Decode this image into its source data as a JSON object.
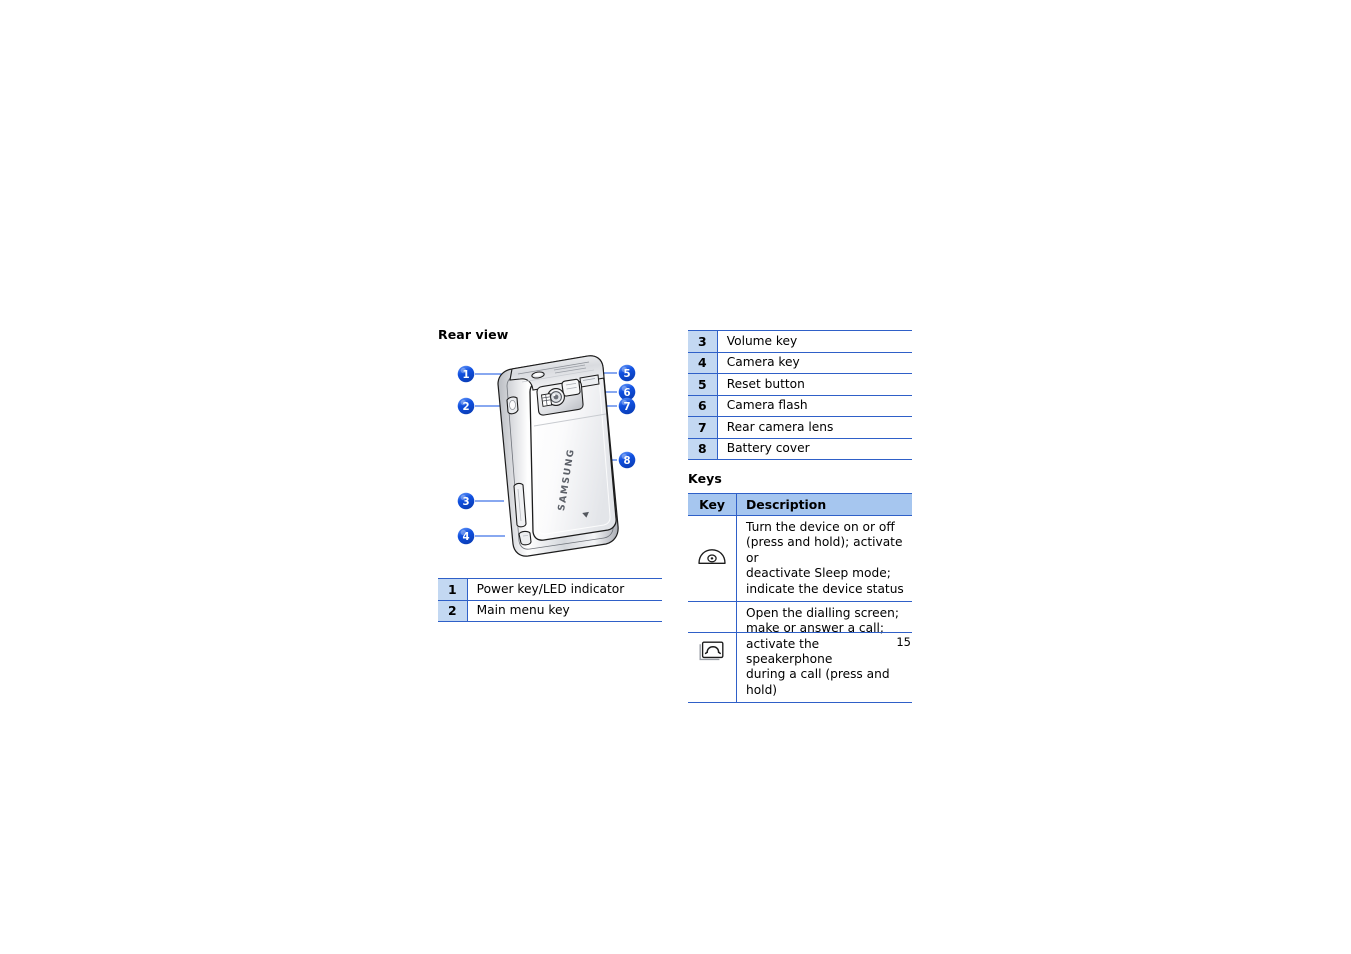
{
  "document": {
    "page_number": "15"
  },
  "rear_view": {
    "heading": "Rear view",
    "illustration": {
      "brand_logo": "SAMSUNG",
      "callouts": [
        "1",
        "2",
        "3",
        "4",
        "5",
        "6",
        "7",
        "8"
      ]
    },
    "table_left": {
      "rows": [
        {
          "num": "1",
          "desc": "Power key/LED indicator"
        },
        {
          "num": "2",
          "desc": "Main menu key"
        }
      ]
    },
    "table_right": {
      "rows": [
        {
          "num": "3",
          "desc": "Volume key"
        },
        {
          "num": "4",
          "desc": "Camera key"
        },
        {
          "num": "5",
          "desc": "Reset button"
        },
        {
          "num": "6",
          "desc": "Camera flash"
        },
        {
          "num": "7",
          "desc": "Rear camera lens"
        },
        {
          "num": "8",
          "desc": "Battery cover"
        }
      ]
    }
  },
  "keys": {
    "heading": "Keys",
    "header": {
      "key": "Key",
      "description": "Description"
    },
    "rows": [
      {
        "icon": "power-key-icon",
        "description": "Turn the device on or off (press and hold); activate or deactivate Sleep mode; indicate the device status",
        "lines": [
          "Turn the device on or off",
          "(press and hold); activate or",
          "deactivate Sleep mode;",
          "indicate the device status"
        ]
      },
      {
        "icon": "call-key-icon",
        "description": "Open the dialling screen; make or answer a call; activate the speakerphone during a call (press and hold)",
        "lines": [
          "Open the dialling screen;",
          "make or answer a call;",
          "activate the speakerphone",
          "during a call (press and hold)"
        ]
      }
    ]
  },
  "colors": {
    "callout_blue": "#1050e0",
    "table_rule": "#2f60c8",
    "num_cell_bg": "#c3d8f2",
    "header_bg": "#a6c6ef"
  }
}
